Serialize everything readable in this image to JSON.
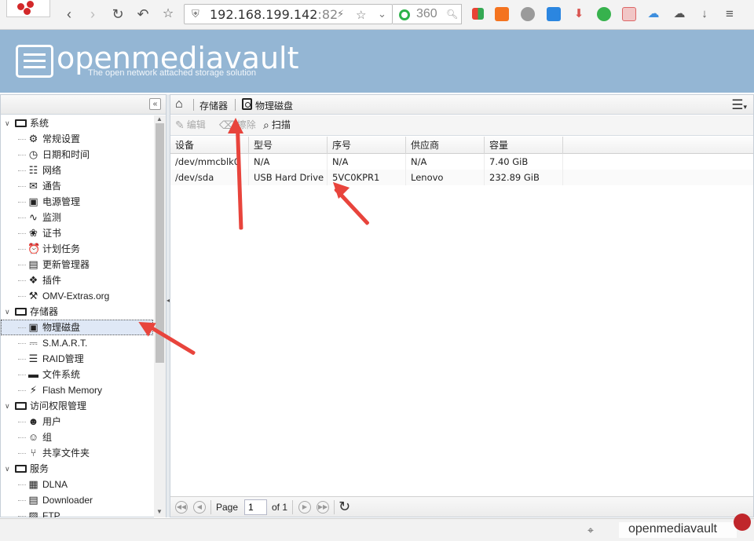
{
  "browser": {
    "url_host": "192.168.199.142",
    "url_port": ":82",
    "search_text": "360"
  },
  "app": {
    "title": "openmediavault",
    "tagline": "The open network attached storage solution"
  },
  "sidebar": {
    "groups": [
      {
        "label": "系统",
        "items": [
          "常规设置",
          "日期和时间",
          "网络",
          "通告",
          "电源管理",
          "监测",
          "证书",
          "计划任务",
          "更新管理器",
          "插件",
          "OMV-Extras.org"
        ]
      },
      {
        "label": "存储器",
        "items": [
          "物理磁盘",
          "S.M.A.R.T.",
          "RAID管理",
          "文件系统",
          "Flash Memory"
        ]
      },
      {
        "label": "访问权限管理",
        "items": [
          "用户",
          "组",
          "共享文件夹"
        ]
      },
      {
        "label": "服务",
        "items": [
          "DLNA",
          "Downloader",
          "FTP"
        ]
      }
    ],
    "selected": "物理磁盘"
  },
  "breadcrumb": {
    "section": "存储器",
    "page": "物理磁盘"
  },
  "toolbar": {
    "edit_label": "编辑",
    "wipe_label": "擦除",
    "scan_label": "扫描"
  },
  "grid": {
    "columns": [
      "设备",
      "型号",
      "序号",
      "供应商",
      "容量"
    ],
    "rows": [
      [
        "/dev/mmcblk0",
        "N/A",
        "N/A",
        "N/A",
        "7.40 GiB"
      ],
      [
        "/dev/sda",
        "USB Hard Drive",
        "5VC0KPR1",
        "Lenovo",
        "232.89 GiB"
      ]
    ]
  },
  "pager": {
    "page_label": "Page",
    "page_value": "1",
    "of_label": "of 1"
  },
  "statusbar": {
    "brand_text": "openmediavault"
  }
}
